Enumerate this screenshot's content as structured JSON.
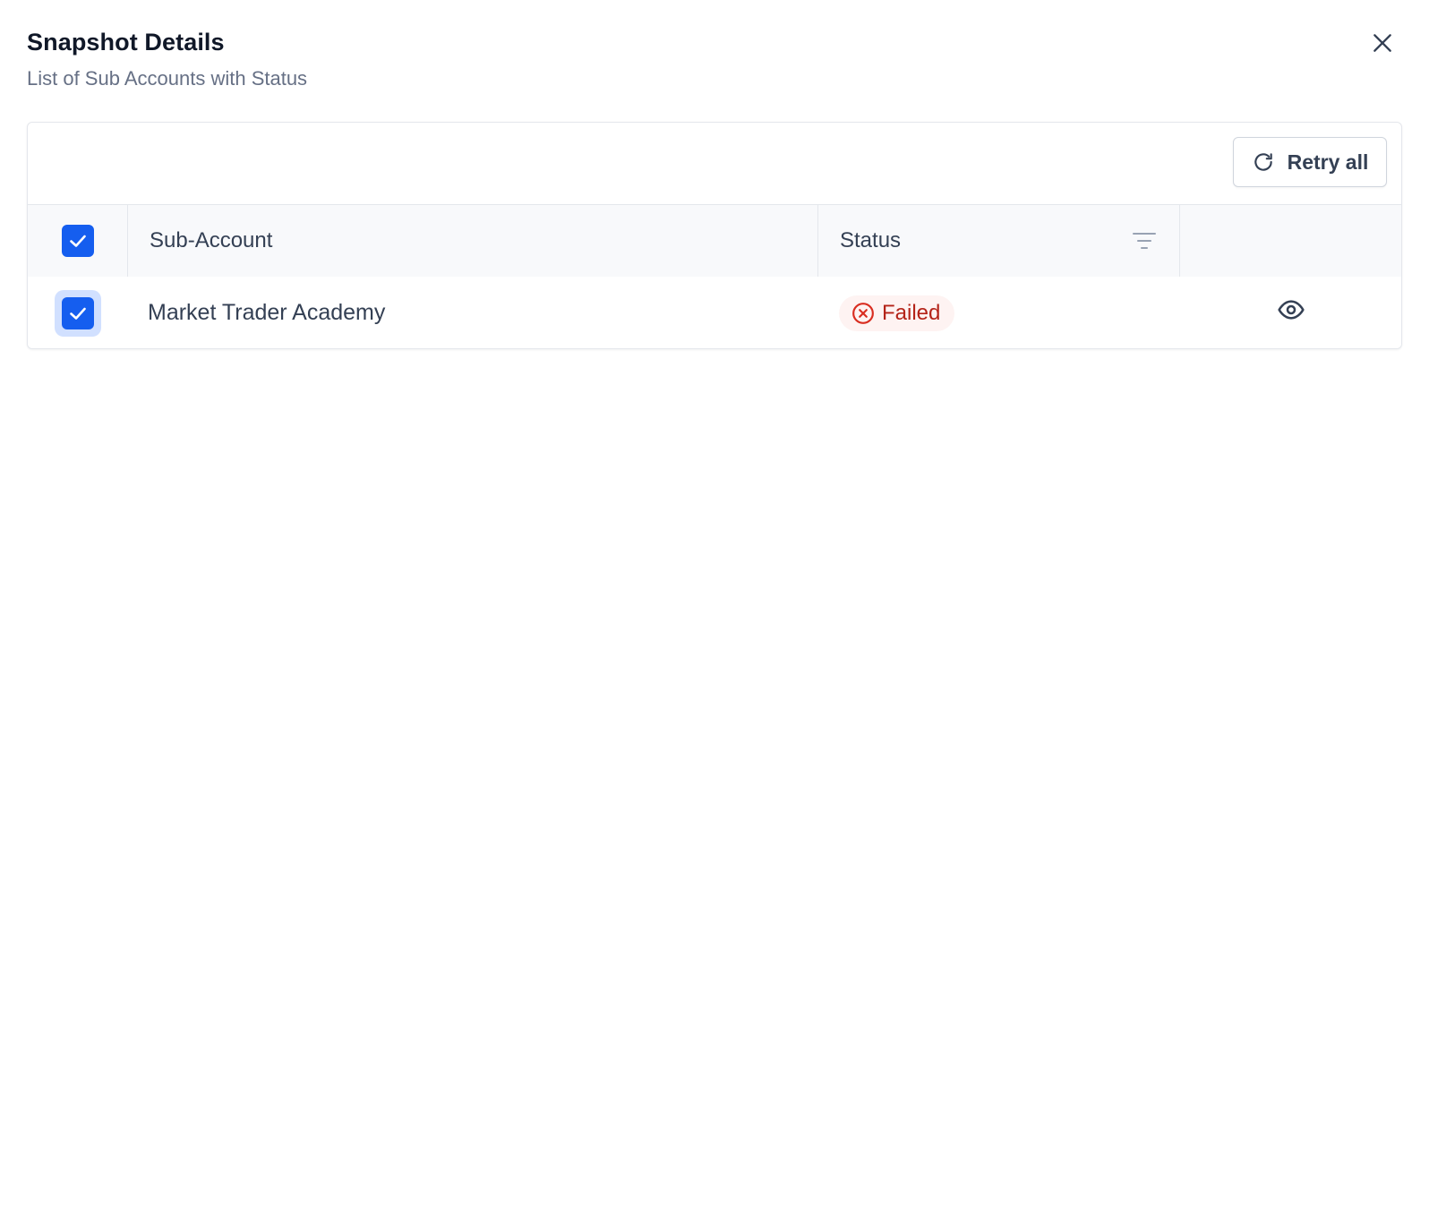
{
  "modal": {
    "title": "Snapshot Details",
    "subtitle": "List of Sub Accounts with Status",
    "close_icon": "close-icon"
  },
  "toolbar": {
    "retry_all_label": "Retry all",
    "retry_icon": "refresh-icon"
  },
  "table": {
    "columns": [
      {
        "key": "select",
        "label": "",
        "checked": true
      },
      {
        "key": "sub_account",
        "label": "Sub-Account"
      },
      {
        "key": "status",
        "label": "Status",
        "filter_icon": "filter-icon"
      },
      {
        "key": "actions",
        "label": ""
      }
    ],
    "rows": [
      {
        "checked": true,
        "sub_account": "Market Trader Academy",
        "status": "Failed",
        "status_icon": "x-circle-icon",
        "action_icon": "eye-icon"
      }
    ]
  },
  "colors": {
    "accent": "#155EEF",
    "failed_text": "#B42318",
    "failed_bg": "#FEF3F2",
    "header_bg": "#F8F9FB",
    "border": "#E4E7EC"
  }
}
